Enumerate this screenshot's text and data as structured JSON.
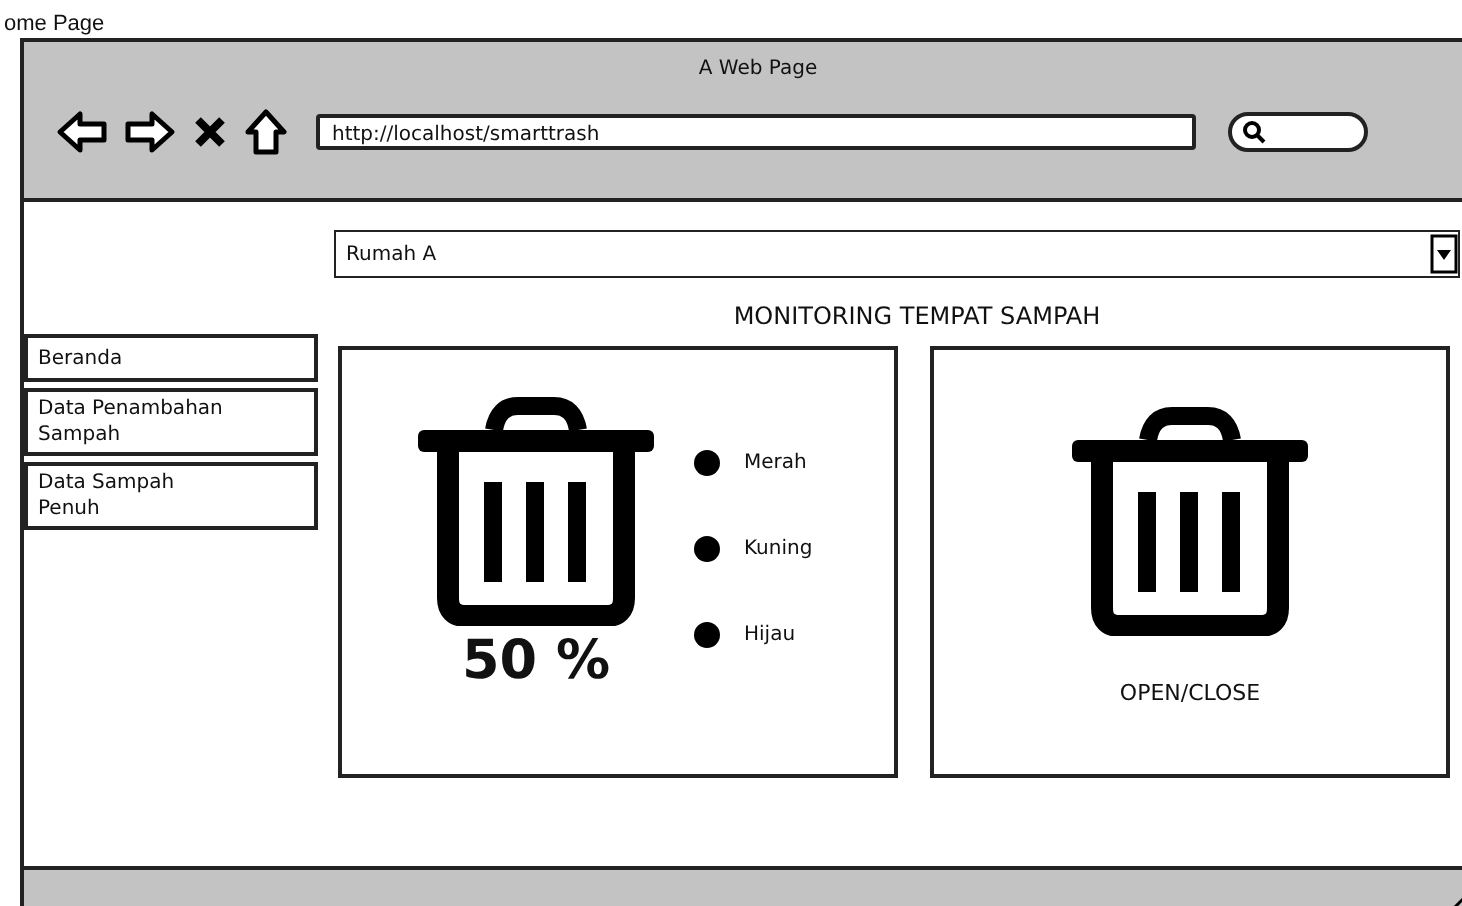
{
  "page_heading": "ome Page",
  "browser": {
    "title": "A Web Page",
    "url": "http://localhost/smarttrash"
  },
  "location_select": {
    "value": "Rumah A"
  },
  "sidebar": {
    "items": [
      {
        "label": "Beranda"
      },
      {
        "label": "Data Penambahan Sampah"
      },
      {
        "label": "Data Sampah Penuh"
      }
    ]
  },
  "heading": "MONITORING TEMPAT SAMPAH",
  "fill_card": {
    "reading": "50 %",
    "legend": [
      {
        "label": "Merah"
      },
      {
        "label": "Kuning"
      },
      {
        "label": "Hijau"
      }
    ]
  },
  "lid_card": {
    "label": "OPEN/CLOSE"
  }
}
